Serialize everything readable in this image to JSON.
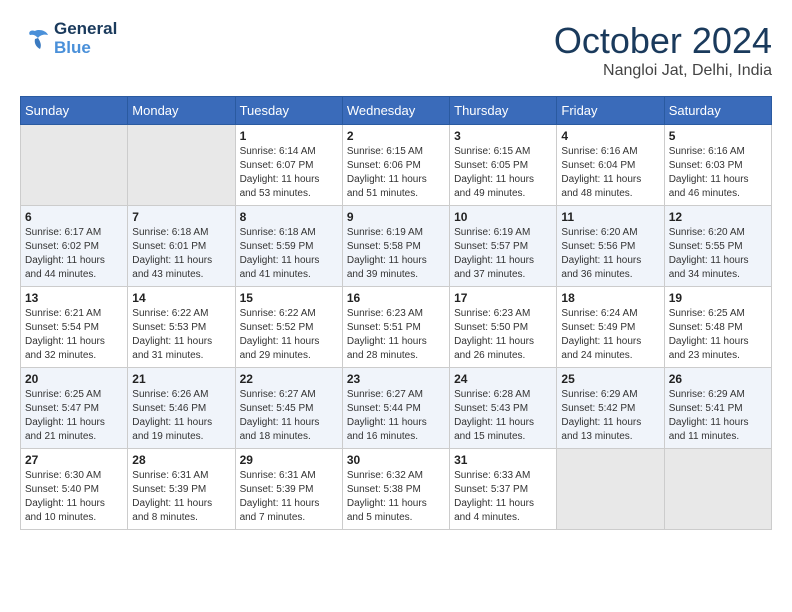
{
  "logo": {
    "line1": "General",
    "line2": "Blue"
  },
  "title": "October 2024",
  "location": "Nangloi Jat, Delhi, India",
  "days_header": [
    "Sunday",
    "Monday",
    "Tuesday",
    "Wednesday",
    "Thursday",
    "Friday",
    "Saturday"
  ],
  "weeks": [
    [
      {
        "num": "",
        "info": ""
      },
      {
        "num": "",
        "info": ""
      },
      {
        "num": "1",
        "info": "Sunrise: 6:14 AM\nSunset: 6:07 PM\nDaylight: 11 hours and 53 minutes."
      },
      {
        "num": "2",
        "info": "Sunrise: 6:15 AM\nSunset: 6:06 PM\nDaylight: 11 hours and 51 minutes."
      },
      {
        "num": "3",
        "info": "Sunrise: 6:15 AM\nSunset: 6:05 PM\nDaylight: 11 hours and 49 minutes."
      },
      {
        "num": "4",
        "info": "Sunrise: 6:16 AM\nSunset: 6:04 PM\nDaylight: 11 hours and 48 minutes."
      },
      {
        "num": "5",
        "info": "Sunrise: 6:16 AM\nSunset: 6:03 PM\nDaylight: 11 hours and 46 minutes."
      }
    ],
    [
      {
        "num": "6",
        "info": "Sunrise: 6:17 AM\nSunset: 6:02 PM\nDaylight: 11 hours and 44 minutes."
      },
      {
        "num": "7",
        "info": "Sunrise: 6:18 AM\nSunset: 6:01 PM\nDaylight: 11 hours and 43 minutes."
      },
      {
        "num": "8",
        "info": "Sunrise: 6:18 AM\nSunset: 5:59 PM\nDaylight: 11 hours and 41 minutes."
      },
      {
        "num": "9",
        "info": "Sunrise: 6:19 AM\nSunset: 5:58 PM\nDaylight: 11 hours and 39 minutes."
      },
      {
        "num": "10",
        "info": "Sunrise: 6:19 AM\nSunset: 5:57 PM\nDaylight: 11 hours and 37 minutes."
      },
      {
        "num": "11",
        "info": "Sunrise: 6:20 AM\nSunset: 5:56 PM\nDaylight: 11 hours and 36 minutes."
      },
      {
        "num": "12",
        "info": "Sunrise: 6:20 AM\nSunset: 5:55 PM\nDaylight: 11 hours and 34 minutes."
      }
    ],
    [
      {
        "num": "13",
        "info": "Sunrise: 6:21 AM\nSunset: 5:54 PM\nDaylight: 11 hours and 32 minutes."
      },
      {
        "num": "14",
        "info": "Sunrise: 6:22 AM\nSunset: 5:53 PM\nDaylight: 11 hours and 31 minutes."
      },
      {
        "num": "15",
        "info": "Sunrise: 6:22 AM\nSunset: 5:52 PM\nDaylight: 11 hours and 29 minutes."
      },
      {
        "num": "16",
        "info": "Sunrise: 6:23 AM\nSunset: 5:51 PM\nDaylight: 11 hours and 28 minutes."
      },
      {
        "num": "17",
        "info": "Sunrise: 6:23 AM\nSunset: 5:50 PM\nDaylight: 11 hours and 26 minutes."
      },
      {
        "num": "18",
        "info": "Sunrise: 6:24 AM\nSunset: 5:49 PM\nDaylight: 11 hours and 24 minutes."
      },
      {
        "num": "19",
        "info": "Sunrise: 6:25 AM\nSunset: 5:48 PM\nDaylight: 11 hours and 23 minutes."
      }
    ],
    [
      {
        "num": "20",
        "info": "Sunrise: 6:25 AM\nSunset: 5:47 PM\nDaylight: 11 hours and 21 minutes."
      },
      {
        "num": "21",
        "info": "Sunrise: 6:26 AM\nSunset: 5:46 PM\nDaylight: 11 hours and 19 minutes."
      },
      {
        "num": "22",
        "info": "Sunrise: 6:27 AM\nSunset: 5:45 PM\nDaylight: 11 hours and 18 minutes."
      },
      {
        "num": "23",
        "info": "Sunrise: 6:27 AM\nSunset: 5:44 PM\nDaylight: 11 hours and 16 minutes."
      },
      {
        "num": "24",
        "info": "Sunrise: 6:28 AM\nSunset: 5:43 PM\nDaylight: 11 hours and 15 minutes."
      },
      {
        "num": "25",
        "info": "Sunrise: 6:29 AM\nSunset: 5:42 PM\nDaylight: 11 hours and 13 minutes."
      },
      {
        "num": "26",
        "info": "Sunrise: 6:29 AM\nSunset: 5:41 PM\nDaylight: 11 hours and 11 minutes."
      }
    ],
    [
      {
        "num": "27",
        "info": "Sunrise: 6:30 AM\nSunset: 5:40 PM\nDaylight: 11 hours and 10 minutes."
      },
      {
        "num": "28",
        "info": "Sunrise: 6:31 AM\nSunset: 5:39 PM\nDaylight: 11 hours and 8 minutes."
      },
      {
        "num": "29",
        "info": "Sunrise: 6:31 AM\nSunset: 5:39 PM\nDaylight: 11 hours and 7 minutes."
      },
      {
        "num": "30",
        "info": "Sunrise: 6:32 AM\nSunset: 5:38 PM\nDaylight: 11 hours and 5 minutes."
      },
      {
        "num": "31",
        "info": "Sunrise: 6:33 AM\nSunset: 5:37 PM\nDaylight: 11 hours and 4 minutes."
      },
      {
        "num": "",
        "info": ""
      },
      {
        "num": "",
        "info": ""
      }
    ]
  ]
}
